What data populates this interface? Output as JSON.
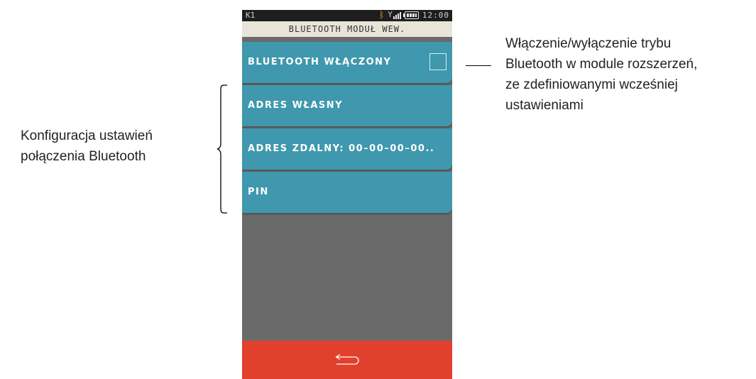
{
  "status_bar": {
    "left_label": "K1",
    "time": "12:00",
    "icons": [
      "bluetooth-icon",
      "signal-icon",
      "battery-icon"
    ]
  },
  "header": {
    "title": "BLUETOOTH MODUŁ WEW."
  },
  "menu": {
    "items": [
      {
        "label": "BLUETOOTH WŁĄCZONY",
        "checked": false
      },
      {
        "label": "ADRES WŁASNY"
      },
      {
        "label": "ADRES ZDALNY: 00–00–00–00.."
      },
      {
        "label": "PIN"
      }
    ]
  },
  "footer": {
    "back_icon": "back-arrow-icon"
  },
  "annotations": {
    "right": [
      "Włączenie/wyłączenie trybu",
      "Bluetooth w module rozszerzeń,",
      "ze zdefiniowanymi wcześniej",
      "ustawieniami"
    ],
    "left": [
      "Konfiguracja ustawień",
      "połączenia Bluetooth"
    ]
  },
  "colors": {
    "menu_item": "#3f98ad",
    "background": "#6b6a6b",
    "footer": "#e0402c",
    "title_bar": "#e9e4d8",
    "status_bar": "#1e1e1e",
    "bluetooth_icon": "#f0b41e"
  }
}
